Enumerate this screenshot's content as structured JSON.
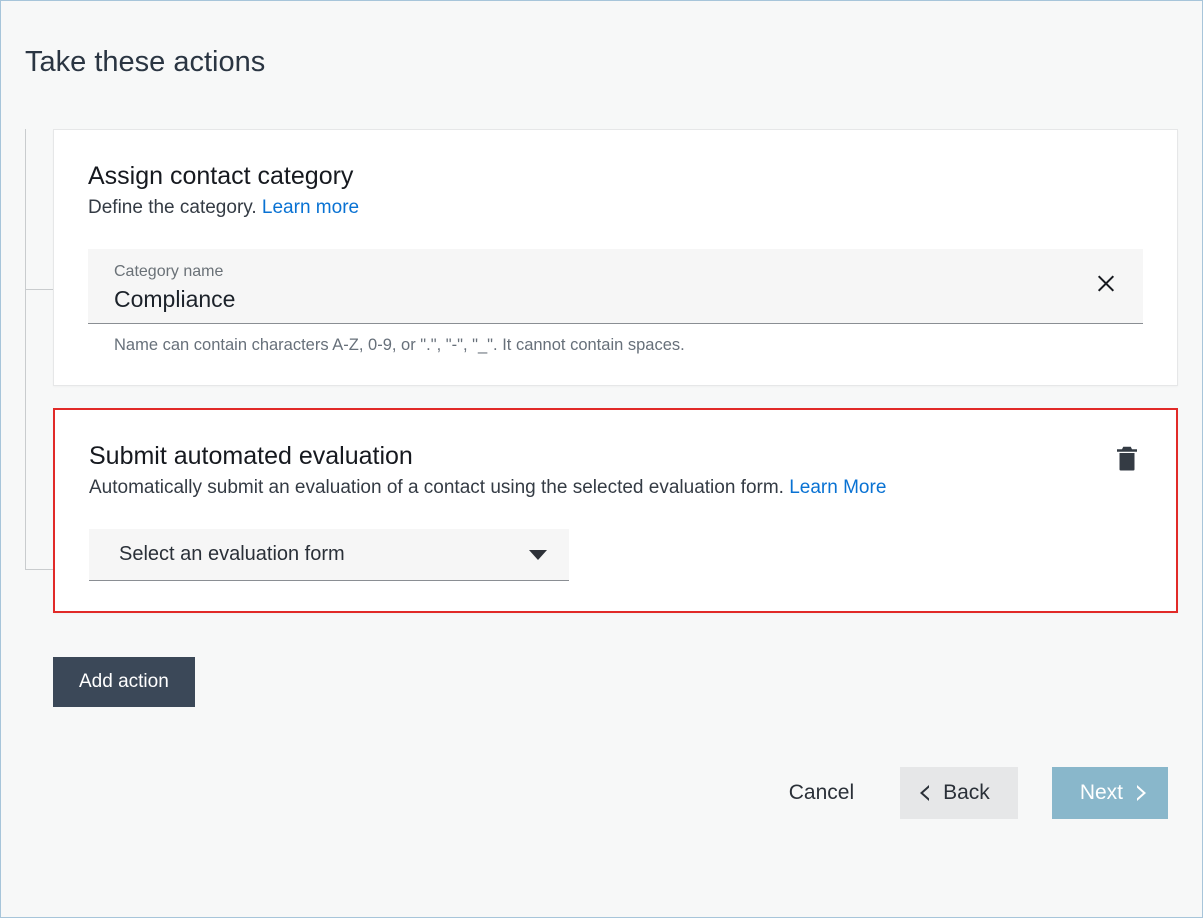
{
  "page_title": "Take these actions",
  "actions": {
    "assign_category": {
      "title": "Assign contact category",
      "subtitle_prefix": "Define the category. ",
      "learn_more": "Learn more",
      "field_label": "Category name",
      "field_value": "Compliance",
      "help_text": "Name can contain characters A-Z, 0-9, or \".\", \"-\", \"_\". It cannot contain spaces."
    },
    "submit_eval": {
      "title": "Submit automated evaluation",
      "subtitle_prefix": "Automatically submit an evaluation of a contact using the selected evaluation form. ",
      "learn_more": "Learn More",
      "select_placeholder": "Select an evaluation form"
    }
  },
  "buttons": {
    "add_action": "Add action",
    "cancel": "Cancel",
    "back": "Back",
    "next": "Next"
  }
}
